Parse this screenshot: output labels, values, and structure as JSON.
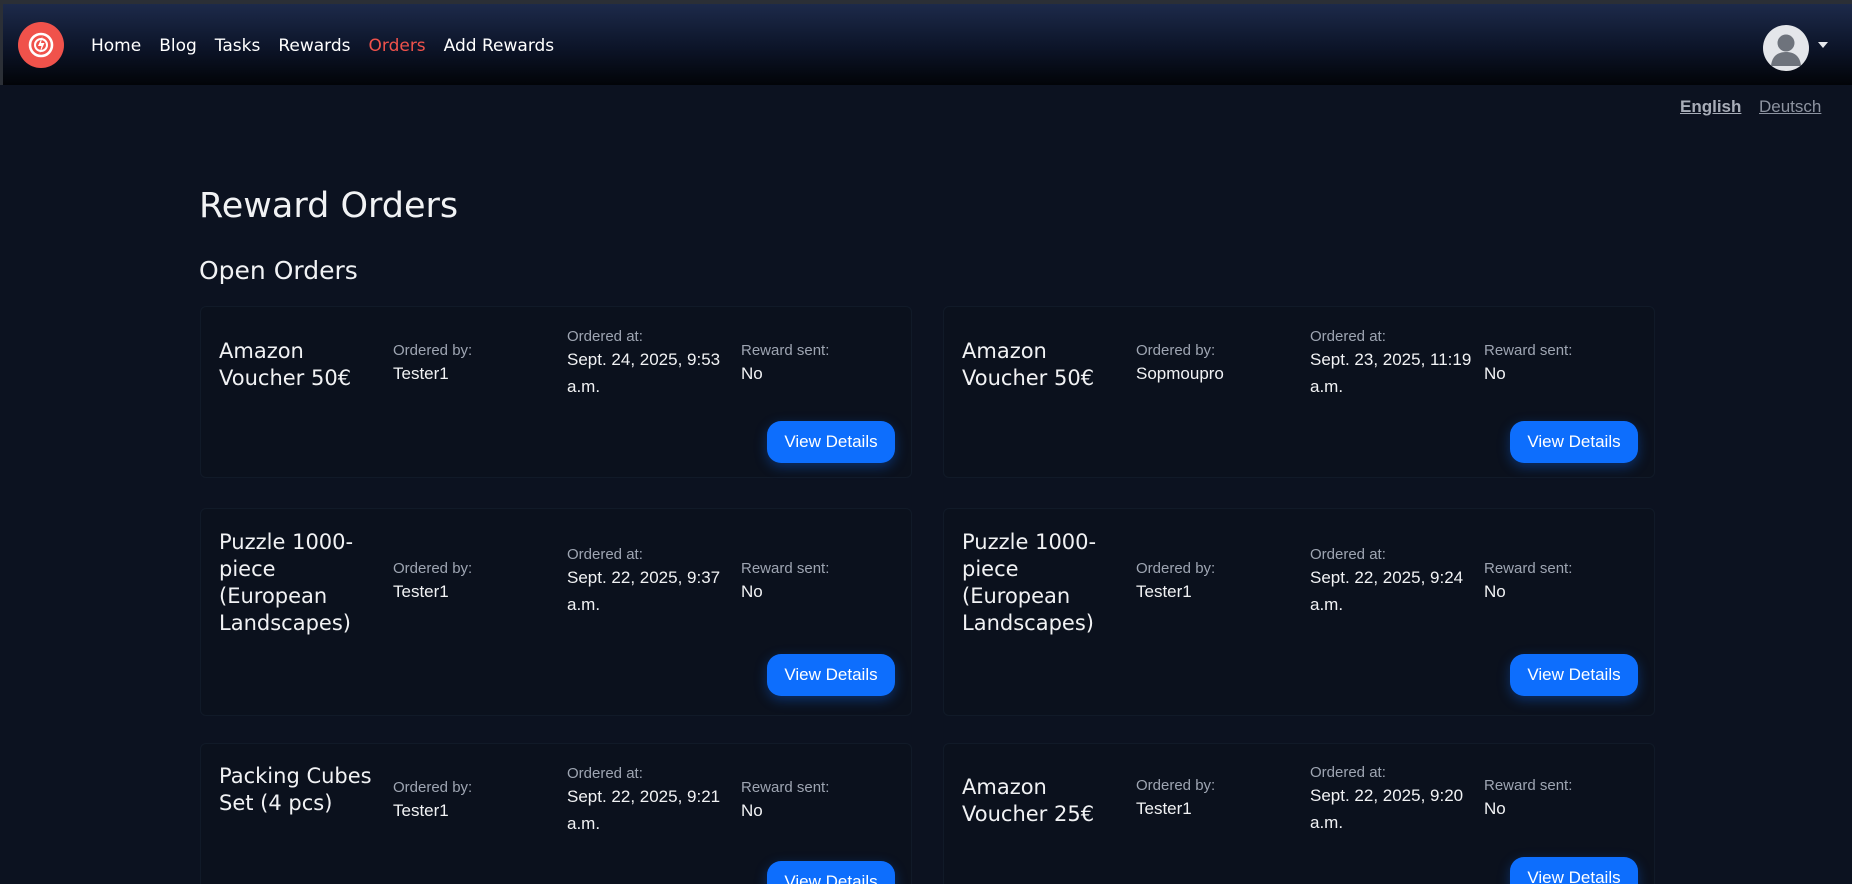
{
  "nav": {
    "items": [
      {
        "label": "Home",
        "active": false
      },
      {
        "label": "Blog",
        "active": false
      },
      {
        "label": "Tasks",
        "active": false
      },
      {
        "label": "Rewards",
        "active": false
      },
      {
        "label": "Orders",
        "active": true
      },
      {
        "label": "Add Rewards",
        "active": false
      }
    ]
  },
  "languages": {
    "current": "English",
    "other": "Deutsch"
  },
  "page": {
    "title": "Reward Orders",
    "section_title": "Open Orders"
  },
  "labels": {
    "ordered_by": "Ordered by:",
    "ordered_at": "Ordered at:",
    "reward_sent": "Reward sent:",
    "view_details": "View Details"
  },
  "orders": [
    {
      "title": "Amazon Voucher 50€",
      "ordered_by": "Tester1",
      "ordered_at": "Sept. 24, 2025, 9:53 a.m.",
      "reward_sent": "No"
    },
    {
      "title": "Amazon Voucher 50€",
      "ordered_by": "Sopmoupro",
      "ordered_at": "Sept. 23, 2025, 11:19 a.m.",
      "reward_sent": "No"
    },
    {
      "title": "Puzzle 1000-piece (European Landscapes)",
      "ordered_by": "Tester1",
      "ordered_at": "Sept. 22, 2025, 9:37 a.m.",
      "reward_sent": "No"
    },
    {
      "title": "Puzzle 1000-piece (European Landscapes)",
      "ordered_by": "Tester1",
      "ordered_at": "Sept. 22, 2025, 9:24 a.m.",
      "reward_sent": "No"
    },
    {
      "title": "Packing Cubes Set (4 pcs)",
      "ordered_by": "Tester1",
      "ordered_at": "Sept. 22, 2025, 9:21 a.m.",
      "reward_sent": "No"
    },
    {
      "title": "Amazon Voucher 25€",
      "ordered_by": "Tester1",
      "ordered_at": "Sept. 22, 2025, 9:20 a.m.",
      "reward_sent": "No"
    }
  ],
  "colors": {
    "accent": "#f0524b",
    "button": "#0d6efd",
    "background": "#0c1220"
  },
  "icons": {
    "logo": "power-logo-icon",
    "avatar": "user-avatar-icon",
    "dropdown": "caret-down-icon"
  }
}
